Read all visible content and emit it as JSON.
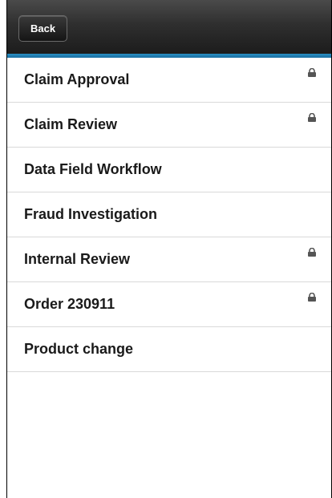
{
  "header": {
    "back_label": "Back",
    "accent_color": "#1a7fb8"
  },
  "list": {
    "items": [
      {
        "label": "Claim Approval",
        "locked": true
      },
      {
        "label": "Claim Review",
        "locked": true
      },
      {
        "label": "Data Field Workflow",
        "locked": false
      },
      {
        "label": "Fraud Investigation",
        "locked": false
      },
      {
        "label": "Internal Review",
        "locked": true
      },
      {
        "label": "Order 230911",
        "locked": true
      },
      {
        "label": "Product change",
        "locked": false
      }
    ],
    "lock_icon": "lock-icon"
  }
}
